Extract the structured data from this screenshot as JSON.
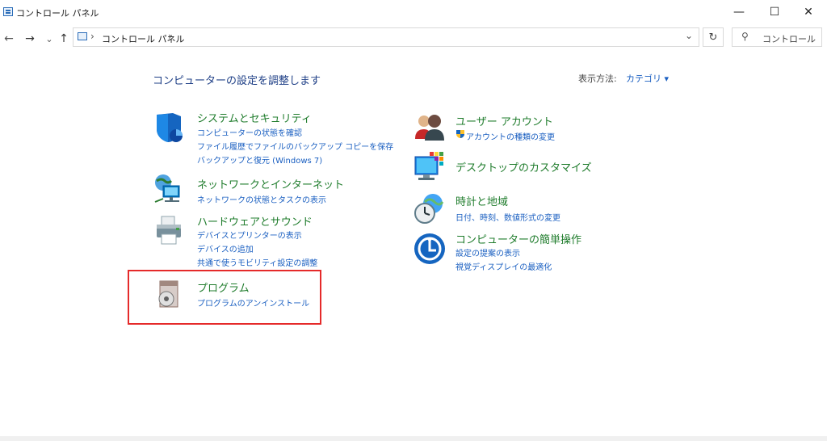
{
  "window": {
    "title": "コントロール パネル",
    "minimize_glyph": "—",
    "maximize_glyph": "☐",
    "close_glyph": "✕"
  },
  "nav": {
    "back_glyph": "←",
    "forward_glyph": "→",
    "recent_glyph": "⌄",
    "up_glyph": "↑",
    "address": "コントロール パネル",
    "breadcrumb_sep_glyph": "›",
    "address_sep_end_glyph": "›",
    "dropdown_glyph": "⌄",
    "refresh_glyph": "↻",
    "search_icon_glyph": "⚲",
    "search_placeholder": "コントロール パ"
  },
  "main": {
    "title": "コンピューターの設定を調整します",
    "view_by_label": "表示方法:",
    "view_by_value": "カテゴリ ▾"
  },
  "categories_left": [
    {
      "title": "システムとセキュリティ",
      "icon": "shield-icon",
      "links": [
        "コンピューターの状態を確認",
        "ファイル履歴でファイルのバックアップ コピーを保存",
        "バックアップと復元 (Windows 7)"
      ]
    },
    {
      "title": "ネットワークとインターネット",
      "icon": "network-icon",
      "links": [
        "ネットワークの状態とタスクの表示"
      ]
    },
    {
      "title": "ハードウェアとサウンド",
      "icon": "printer-icon",
      "links": [
        "デバイスとプリンターの表示",
        "デバイスの追加",
        "共通で使うモビリティ設定の調整"
      ]
    },
    {
      "title": "プログラム",
      "icon": "programs-icon",
      "links": [
        "プログラムのアンインストール"
      ]
    }
  ],
  "categories_right": [
    {
      "title": "ユーザー アカウント",
      "icon": "users-icon",
      "links": [
        "アカウントの種類の変更"
      ]
    },
    {
      "title": "デスクトップのカスタマイズ",
      "icon": "desktop-icon",
      "links": []
    },
    {
      "title": "時計と地域",
      "icon": "clock-globe-icon",
      "links": [
        "日付、時刻、数値形式の変更"
      ]
    },
    {
      "title": "コンピューターの簡単操作",
      "icon": "ease-of-access-icon",
      "links": [
        "設定の提案の表示",
        "視覚ディスプレイの最適化"
      ]
    }
  ],
  "colors": {
    "title_blue": "#1e3f86",
    "category_green": "#1f7c2c",
    "link_blue": "#1a5fc1",
    "highlight_red": "#e52a2a"
  }
}
